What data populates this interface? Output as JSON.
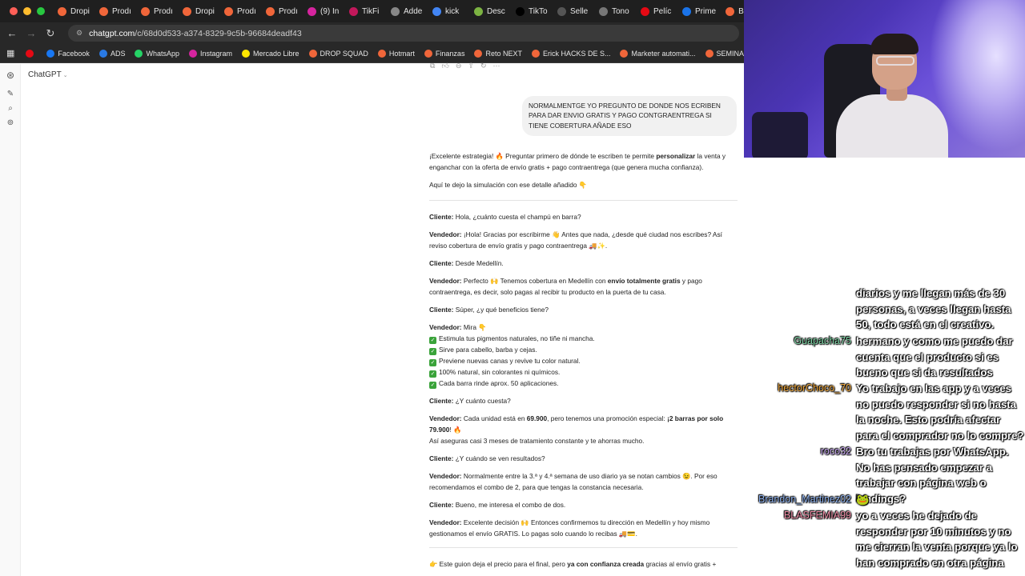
{
  "browser": {
    "traffic_colors": [
      "#ff5f57",
      "#febc2e",
      "#28c840"
    ],
    "tabs": [
      {
        "label": "Dropi",
        "icon": "orange-circle-icon",
        "color": "#f0663a"
      },
      {
        "label": "Prodı",
        "icon": "orange-circle-icon",
        "color": "#f0663a"
      },
      {
        "label": "Prodı",
        "icon": "orange-circle-icon",
        "color": "#f0663a"
      },
      {
        "label": "Dropi",
        "icon": "orange-circle-icon",
        "color": "#f0663a"
      },
      {
        "label": "Prodı",
        "icon": "orange-circle-icon",
        "color": "#f0663a"
      },
      {
        "label": "Prodı",
        "icon": "orange-circle-icon",
        "color": "#f0663a"
      },
      {
        "label": "(9) In",
        "icon": "instagram-icon",
        "color": "#d6249f"
      },
      {
        "label": "TikFi",
        "icon": "tikfinity-icon",
        "color": "#c2185b"
      },
      {
        "label": "Adde",
        "icon": "puzzle-icon",
        "color": "#888888"
      },
      {
        "label": "kick",
        "icon": "google-icon",
        "color": "#4285f4"
      },
      {
        "label": "Desc",
        "icon": "download-icon",
        "color": "#7cb342"
      },
      {
        "label": "TikTo",
        "icon": "tiktok-icon",
        "color": "#000000"
      },
      {
        "label": "Selle",
        "icon": "seller-icon",
        "color": "#555555"
      },
      {
        "label": "Tono",
        "icon": "globe-icon",
        "color": "#777777"
      },
      {
        "label": "Pelíc",
        "icon": "netflix-icon",
        "color": "#e50914"
      },
      {
        "label": "Prime",
        "icon": "prime-icon",
        "color": "#1a73e8"
      },
      {
        "label": "BOF",
        "icon": "orange-circle-icon",
        "color": "#f0663a"
      }
    ],
    "url_host": "chatgpt.com",
    "url_path": "/c/68d0d533-a374-8329-9c5b-96684deadf43",
    "bookmarks": [
      {
        "label": "",
        "icon": "netflix-icon",
        "color": "#e50914"
      },
      {
        "label": "Facebook",
        "icon": "facebook-icon",
        "color": "#1877f2"
      },
      {
        "label": "ADS",
        "icon": "meta-icon",
        "color": "#2a7ae4"
      },
      {
        "label": "WhatsApp",
        "icon": "whatsapp-icon",
        "color": "#25d366"
      },
      {
        "label": "Instagram",
        "icon": "instagram-icon",
        "color": "#d6249f"
      },
      {
        "label": "Mercado Libre",
        "icon": "mercadolibre-icon",
        "color": "#ffe600"
      },
      {
        "label": "DROP SQUAD",
        "icon": "flame-icon",
        "color": "#f0663a"
      },
      {
        "label": "Hotmart",
        "icon": "flame-icon",
        "color": "#f0663a"
      },
      {
        "label": "Finanzas",
        "icon": "flame-icon",
        "color": "#f0663a"
      },
      {
        "label": "Reto NEXT",
        "icon": "flame-icon",
        "color": "#f0663a"
      },
      {
        "label": "Erick HACKS DE S...",
        "icon": "flame-icon",
        "color": "#f0663a"
      },
      {
        "label": "Marketer automati...",
        "icon": "flame-icon",
        "color": "#f0663a"
      },
      {
        "label": "SEMINARIOS ONLI...",
        "icon": "flame-icon",
        "color": "#f0663a"
      }
    ]
  },
  "chatgpt": {
    "model_label": "ChatGPT",
    "user_message": "NORMALMENTGE YO PREGUNTO DE DONDE NOS ECRIBEN PARA DAR ENVIO GRATIS Y PAGO CONTGRAENTREGA SI TIENE COBERTURA AÑADE ESO",
    "intro_1a": "¡Excelente estrategia! 🔥 Preguntar primero de dónde te escriben te permite ",
    "intro_1b": "personalizar",
    "intro_1c": " la venta y enganchar con la oferta de envío gratis + pago contraentrega (que genera mucha confianza).",
    "intro_2": "Aquí te dejo la simulación con ese detalle añadido 👇",
    "cliente": "Cliente:",
    "vendedor": "Vendedor:",
    "l1": " Hola, ¿cuánto cuesta el champú en barra?",
    "l2": " ¡Hola! Gracias por escribirme 👋 Antes que nada, ¿desde qué ciudad nos escribes? Así reviso cobertura de envío gratis y pago contraentrega 🚚✨.",
    "l3": " Desde Medellín.",
    "l4a": " Perfecto 🙌 Tenemos cobertura en Medellín con ",
    "l4b": "envío totalmente gratis",
    "l4c": " y pago contraentrega, es decir, solo pagas al recibir tu producto en la puerta de tu casa.",
    "l5": " Súper, ¿y qué beneficios tiene?",
    "l6": " Mira 👇",
    "benefits": [
      "Estimula tus pigmentos naturales, no tiñe ni mancha.",
      "Sirve para cabello, barba y cejas.",
      "Previene nuevas canas y revive tu color natural.",
      "100% natural, sin colorantes ni químicos.",
      "Cada barra rinde aprox. 50 aplicaciones."
    ],
    "l7": " ¿Y cuánto cuesta?",
    "l8a": " Cada unidad está en ",
    "l8b": "69.900",
    "l8c": ", pero tenemos una promoción especial: ",
    "l8d": "¡2 barras por solo 79.900",
    "l8e": "! 🔥",
    "l8f": "Así aseguras casi 3 meses de tratamiento constante y te ahorras mucho.",
    "l9": " ¿Y cuándo se ven resultados?",
    "l10": " Normalmente entre la 3.ª y 4.ª semana de uso diario ya se notan cambios 😉. Por eso recomendamos el combo de 2, para que tengas la constancia necesaria.",
    "l11": " Bueno, me interesa el combo de dos.",
    "l12": " Excelente decisión 🙌 Entonces confirmemos tu dirección en Medellín y hoy mismo gestionamos el envío GRATIS. Lo pagas solo cuando lo recibas 🚚💳.",
    "outro_a": "👉 Este guion deja el precio para el final, pero ",
    "outro_b": "ya con confianza creada",
    "outro_c": " gracias al envío gratis +"
  },
  "livechat": {
    "messages": [
      {
        "user": "",
        "user_color": "#ffffff",
        "text": "diarios y me llegan más de 30 personas, a veces llegan hasta 50, todo está en el creativo."
      },
      {
        "user": "Guapacha75",
        "user_color": "#7fd4a6",
        "text": "hermano y como me puedo dar cuenta que el producto si es bueno que si da resultados"
      },
      {
        "user": "hectorChoco_70",
        "user_color": "#f0a73a",
        "text": "Yo trabajo en las app y a veces no puedo responder si no hasta la noche. Esto podría afectar para el comprador no lo compre?"
      },
      {
        "user": "roco32",
        "user_color": "#c6a7f0",
        "text": "Bro tu trabajas por WhatsApp. No has pensado empezar a trabajar con página web o landings?"
      },
      {
        "user": "Brandon_Martinez02",
        "user_color": "#8fb3f0",
        "text": "🐸"
      },
      {
        "user": "BLASFEMIA99",
        "user_color": "#f08fa8",
        "text": "yo a veces he dejado de responder por 10 minutos y no me cierran la venta porque ya lo han comprado en otra página"
      }
    ]
  }
}
